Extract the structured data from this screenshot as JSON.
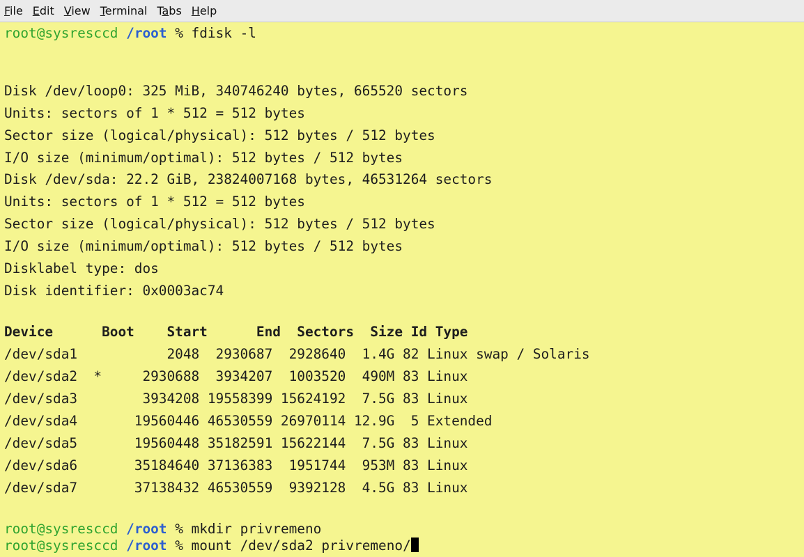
{
  "menu": [
    {
      "label": "File",
      "u": "F",
      "rest": "ile"
    },
    {
      "label": "Edit",
      "u": "E",
      "rest": "dit"
    },
    {
      "label": "View",
      "u": "V",
      "rest": "iew"
    },
    {
      "label": "Terminal",
      "u": "T",
      "rest": "erminal"
    },
    {
      "label": "Tabs",
      "pre": "T",
      "u": "a",
      "rest": "bs"
    },
    {
      "label": "Help",
      "u": "H",
      "rest": "elp"
    }
  ],
  "prompt": {
    "user_host": "root@sysresccd",
    "dir": "/root",
    "sep": " % "
  },
  "commands": [
    "fdisk -l",
    "mkdir privremeno",
    "mount /dev/sda2 privremeno/"
  ],
  "output": [
    "Disk /dev/loop0: 325 MiB, 340746240 bytes, 665520 sectors",
    "Units: sectors of 1 * 512 = 512 bytes",
    "Sector size (logical/physical): 512 bytes / 512 bytes",
    "I/O size (minimum/optimal): 512 bytes / 512 bytes",
    "Disk /dev/sda: 22.2 GiB, 23824007168 bytes, 46531264 sectors",
    "Units: sectors of 1 * 512 = 512 bytes",
    "Sector size (logical/physical): 512 bytes / 512 bytes",
    "I/O size (minimum/optimal): 512 bytes / 512 bytes",
    "Disklabel type: dos",
    "Disk identifier: 0x0003ac74"
  ],
  "partition_header": "Device      Boot    Start      End  Sectors  Size Id Type",
  "partitions": [
    "/dev/sda1           2048  2930687  2928640  1.4G 82 Linux swap / Solaris",
    "/dev/sda2  *     2930688  3934207  1003520  490M 83 Linux",
    "/dev/sda3        3934208 19558399 15624192  7.5G 83 Linux",
    "/dev/sda4       19560446 46530559 26970114 12.9G  5 Extended",
    "/dev/sda5       19560448 35182591 15622144  7.5G 83 Linux",
    "/dev/sda6       35184640 37136383  1951744  953M 83 Linux",
    "/dev/sda7       37138432 46530559  9392128  4.5G 83 Linux"
  ]
}
